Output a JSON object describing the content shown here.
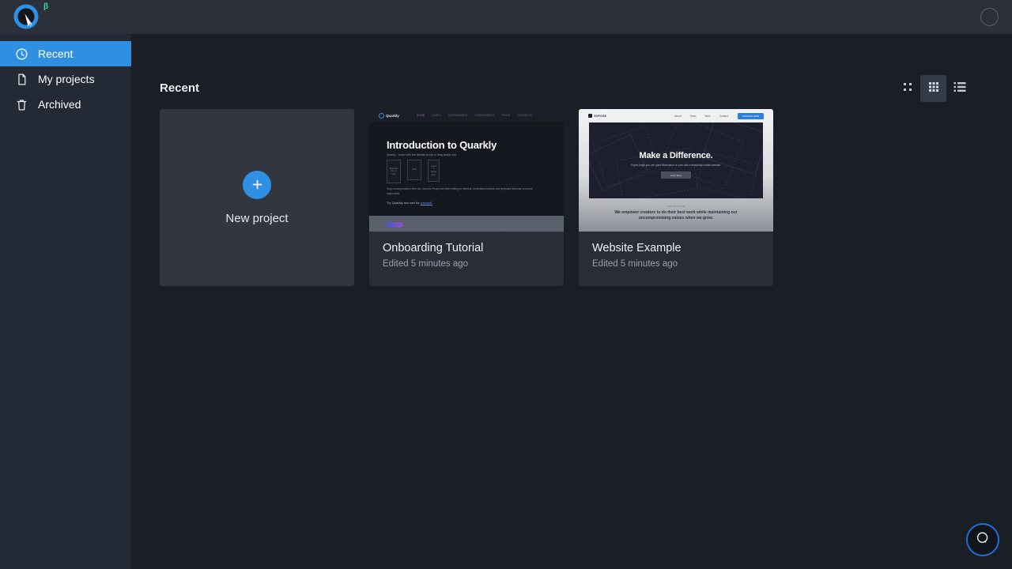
{
  "app": {
    "brand_name": "Quarkly",
    "beta_badge": "β",
    "accent_color": "#2f8fe0",
    "beta_color": "#3ddc97",
    "background_color": "#1a1e27",
    "sidebar_color": "#242936",
    "topbar_color": "#2b303b"
  },
  "topbar": {
    "logo_icon": "quarkly-q-logo",
    "avatar_icon": "user-avatar-placeholder"
  },
  "sidebar": {
    "items": [
      {
        "id": "recent",
        "label": "Recent",
        "icon": "clock-icon",
        "active": true
      },
      {
        "id": "projects",
        "label": "My projects",
        "icon": "document-icon",
        "active": false
      },
      {
        "id": "archived",
        "label": "Archived",
        "icon": "trash-icon",
        "active": false
      }
    ]
  },
  "main": {
    "title": "Recent",
    "view_modes": [
      {
        "id": "compact-grid",
        "icon": "grid-2x2-icon",
        "selected": false
      },
      {
        "id": "grid",
        "icon": "grid-3x3-icon",
        "selected": true
      },
      {
        "id": "list",
        "icon": "list-icon",
        "selected": false
      }
    ],
    "new_project": {
      "label": "New project",
      "icon": "plus-icon"
    },
    "projects": [
      {
        "title": "Onboarding Tutorial",
        "subtitle": "Edited 5 minutes ago",
        "thumbnail": {
          "kind": "dark-landing-page",
          "brand": "Quarkly",
          "nav_links": [
            "HOME",
            "CASES",
            "CUSTOMIZING",
            "COMPONENTS",
            "PRICE",
            "CONTACTS"
          ],
          "heading": "Introduction to Quarkly",
          "subheading": "Quarkly - create with the familiar blocks or drag design tool",
          "boxes": [
            "Drag first box in here",
            "Drop",
            "Leave it where here"
          ],
          "paragraph": "Drop a ready-made in here too. Now the Props and other editing on element. Understand buttons and keyboard shortcuts are more responsible.",
          "cta_text": "Try Quarkly and see for",
          "cta_link": "yourself."
        }
      },
      {
        "title": "Website Example",
        "subtitle": "Edited 5 minutes ago",
        "thumbnail": {
          "kind": "light-landing-page",
          "brand": "EXPOSE",
          "nav_links": [
            "About",
            "Team",
            "Work",
            "Contact"
          ],
          "cta_button": "CONTACT NOW",
          "heading": "Make a Difference.",
          "subheading": "Expert begin you use good information on your with a beautifully crafted website.",
          "hero_button": "Learn More",
          "eyebrow": "OUR MISSION",
          "body": "We empower creators to do their best work while maintaining our uncompromising values when we grow."
        }
      }
    ]
  },
  "help": {
    "icon": "chat-bubble-icon",
    "border_color": "#1f6fd0"
  }
}
